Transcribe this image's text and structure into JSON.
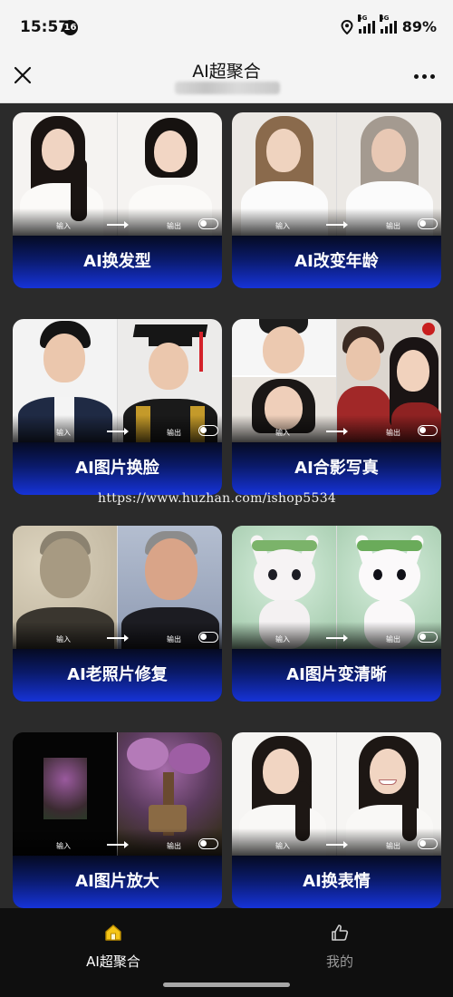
{
  "status_bar": {
    "time": "15:57",
    "badge": "16",
    "net_1": "5G",
    "net_2": "4G",
    "battery": "89%"
  },
  "header": {
    "title": "AI超聚合"
  },
  "cards": [
    {
      "label": "AI换发型",
      "input": "输入",
      "output": "输出"
    },
    {
      "label": "AI改变年龄",
      "input": "输入",
      "output": "输出"
    },
    {
      "label": "AI图片换脸",
      "input": "输入",
      "output": "输出"
    },
    {
      "label": "AI合影写真",
      "input": "输入",
      "output": "输出"
    },
    {
      "label": "AI老照片修复",
      "input": "输入",
      "output": "输出"
    },
    {
      "label": "AI图片变清晰",
      "input": "输入",
      "output": "输出"
    },
    {
      "label": "AI图片放大",
      "input": "输入",
      "output": "输出"
    },
    {
      "label": "AI换表情",
      "input": "输入",
      "output": "输出"
    }
  ],
  "watermark": "https://www.huzhan.com/ishop5534",
  "bottom_nav": {
    "items": [
      {
        "label": "AI超聚合",
        "icon": "home-icon",
        "active": true
      },
      {
        "label": "我的",
        "icon": "thumbs-up-icon",
        "active": false
      }
    ]
  },
  "colors": {
    "accent_blue": "#1633d8",
    "background": "#2b2b2b",
    "nav_background": "#0f0f0f"
  }
}
